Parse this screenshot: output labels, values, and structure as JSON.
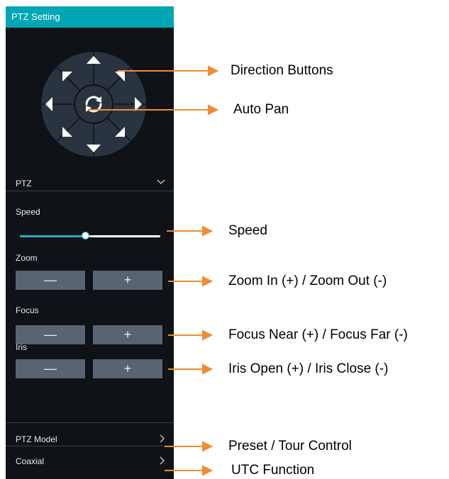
{
  "panel": {
    "title": "PTZ Setting",
    "mode_label": "PTZ",
    "speed_label": "Speed",
    "speed_level": 0.47,
    "zoom_label": "Zoom",
    "focus_label": "Focus",
    "iris_label": "Iris",
    "minus_symbol": "—",
    "plus_symbol": "+",
    "model_label": "PTZ Model",
    "coaxial_label": "Coaxial"
  },
  "annotations": {
    "direction": "Direction Buttons",
    "auto_pan": "Auto Pan",
    "speed": "Speed",
    "zoom": "Zoom In (+) / Zoom Out (-)",
    "focus": "Focus Near (+) / Focus Far (-)",
    "iris": "Iris Open (+) / Iris Close (-)",
    "preset": "Preset / Tour Control",
    "utc": "UTC Function"
  },
  "colors": {
    "header": "#00a6b4",
    "panel_bg": "#0f1216",
    "button_bg": "#586373",
    "accent": "#29a9c4",
    "arrow": "#f08c32"
  },
  "icons": {
    "direction_pad": "direction-pad-icon",
    "auto_pan": "refresh-icon",
    "dropdown": "chevron-down-icon",
    "submenu": "chevron-right-icon"
  }
}
